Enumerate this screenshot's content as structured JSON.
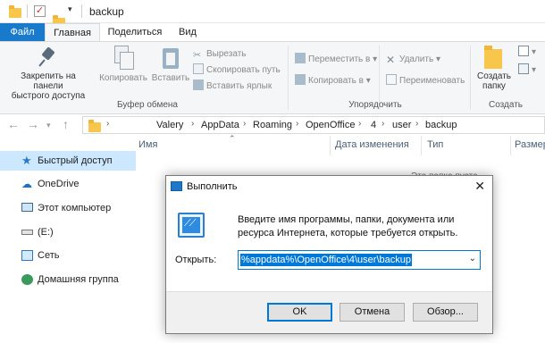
{
  "window": {
    "title": "backup"
  },
  "ribbon_tabs": [
    "Файл",
    "Главная",
    "Поделиться",
    "Вид"
  ],
  "ribbon": {
    "clipboard": {
      "pin_label_1": "Закрепить на панели",
      "pin_label_2": "быстрого доступа",
      "copy": "Копировать",
      "paste": "Вставить",
      "cut": "Вырезать",
      "copy_path": "Скопировать путь",
      "paste_shortcut": "Вставить ярлык",
      "group": "Буфер обмена"
    },
    "organize": {
      "move_to": "Переместить в",
      "copy_to": "Копировать в",
      "delete": "Удалить",
      "rename": "Переименовать",
      "group": "Упорядочить"
    },
    "create": {
      "new_folder_1": "Создать",
      "new_folder_2": "папку",
      "group": "Создать"
    }
  },
  "breadcrumb": [
    "Valery",
    "AppData",
    "Roaming",
    "OpenOffice",
    "4",
    "user",
    "backup"
  ],
  "nav": [
    {
      "label": "Быстрый доступ",
      "icon": "star-icon",
      "selected": true
    },
    {
      "label": "OneDrive",
      "icon": "cloud-icon"
    },
    {
      "label": "Этот компьютер",
      "icon": "computer-icon"
    },
    {
      "label": "(E:)",
      "icon": "drive-icon"
    },
    {
      "label": "Сеть",
      "icon": "network-icon"
    },
    {
      "label": "Домашняя группа",
      "icon": "homegroup-icon"
    }
  ],
  "columns": {
    "name": "Имя",
    "date": "Дата изменения",
    "type": "Тип",
    "size": "Размер"
  },
  "empty_note": "Эта папка пуста.",
  "run_dialog": {
    "title": "Выполнить",
    "description": "Введите имя программы, папки, документа или ресурса Интернета, которые требуется открыть.",
    "open_label": "Открыть:",
    "input_value": "%appdata%\\OpenOffice\\4\\user\\backup",
    "ok": "OK",
    "cancel": "Отмена",
    "browse": "Обзор..."
  },
  "colors": {
    "file_tab": "#1979ca",
    "selection": "#cce8ff",
    "accent": "#0078d7"
  }
}
